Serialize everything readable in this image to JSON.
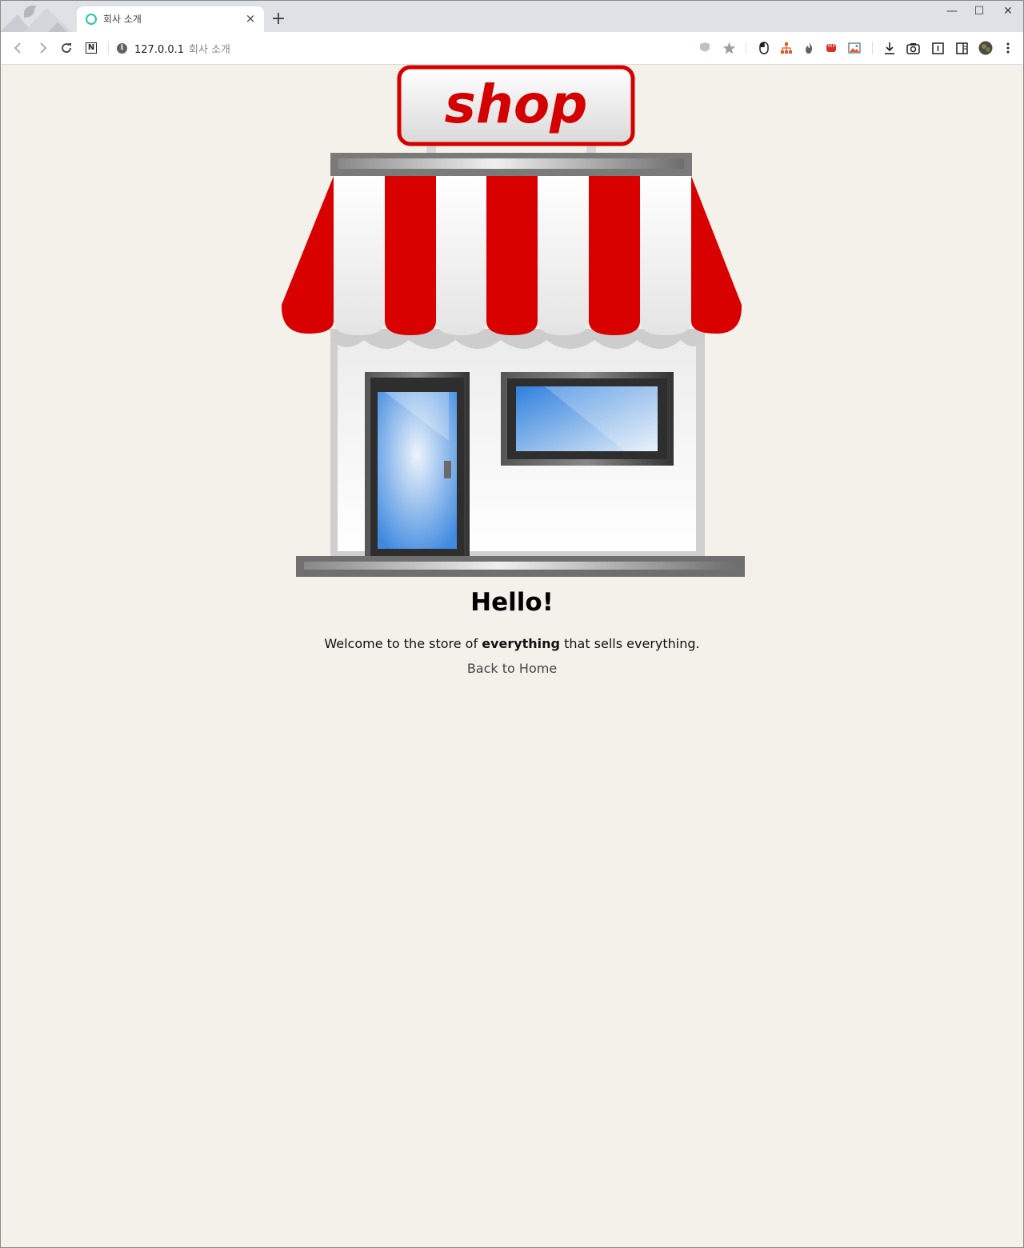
{
  "browser": {
    "tab_title": "회사 소개",
    "tab_close": "×",
    "new_tab": "+",
    "window_controls": {
      "minimize": "—",
      "maximize": "☐",
      "close": "✕"
    },
    "address_bar": {
      "url": "127.0.0.1",
      "page_title": "회사 소개"
    },
    "nav": {
      "back_icon": "chevron-left-icon",
      "forward_icon": "chevron-right-icon",
      "reload_icon": "reload-icon",
      "notion_icon": "N"
    },
    "extensions": [
      "shield-icon",
      "star-icon",
      "mouse-icon",
      "sitemap-icon",
      "fire-icon",
      "fist-icon",
      "image-icon",
      "download-icon",
      "camera-icon",
      "reader-icon",
      "sidebar-icon",
      "profile-avatar"
    ]
  },
  "page": {
    "sign_text": "shop",
    "heading": "Hello!",
    "welcome_before": "Welcome to the store of ",
    "welcome_bold": "everything",
    "welcome_after": " that sells everything.",
    "back_link": "Back to Home",
    "colors": {
      "awning_red": "#d90000",
      "background": "#f4f1ea",
      "glass_blue": "#4a90e2"
    }
  }
}
